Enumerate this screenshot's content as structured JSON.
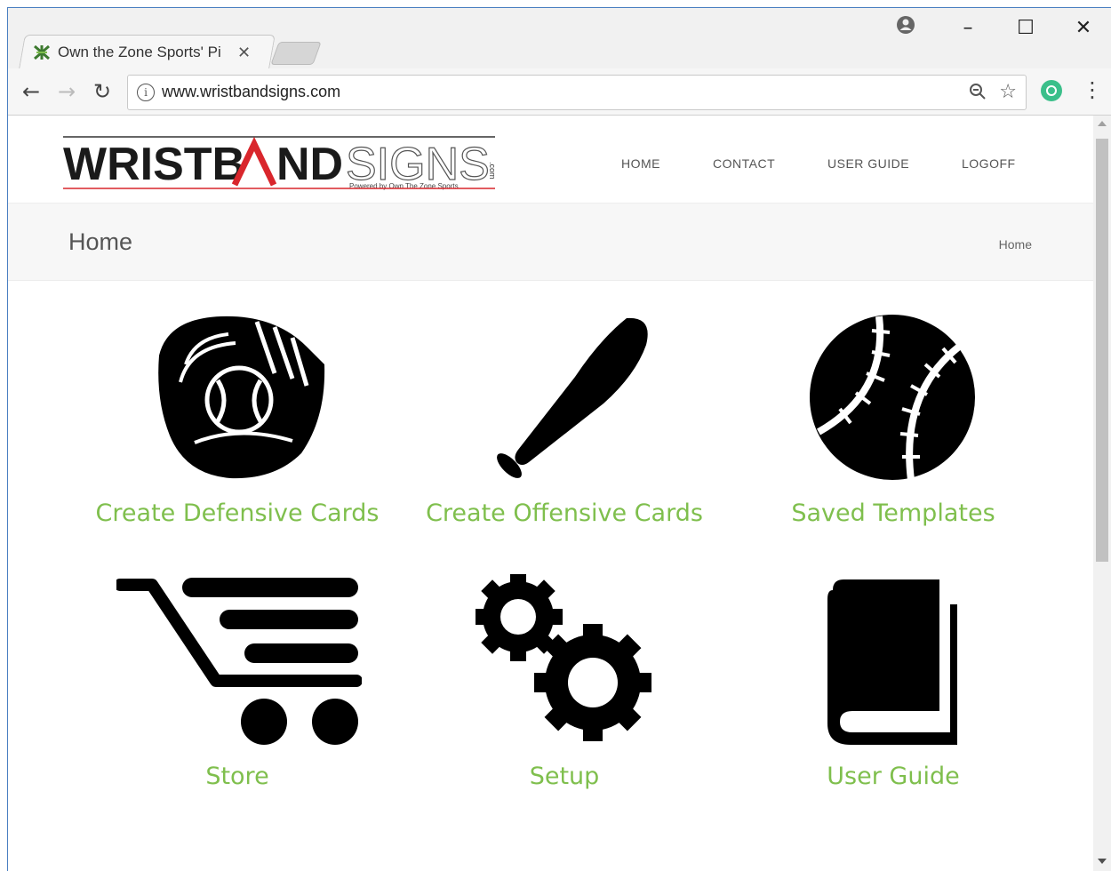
{
  "browser": {
    "tab_title": "Own the Zone Sports' Pi",
    "url": "www.wristbandsigns.com"
  },
  "site": {
    "logo_text_bold": "WRISTB",
    "logo_text_a": "A",
    "logo_text_nd": "ND",
    "logo_text_light": "SIGNS",
    "logo_tagline": "Powered by Own The Zone Sports",
    "logo_suffix": ".com",
    "nav": [
      "HOME",
      "CONTACT",
      "USER GUIDE",
      "LOGOFF"
    ],
    "page_title": "Home",
    "breadcrumb": "Home"
  },
  "tiles": [
    {
      "label": "Create Defensive Cards",
      "icon": "baseball-glove-icon"
    },
    {
      "label": "Create Offensive Cards",
      "icon": "baseball-bat-icon"
    },
    {
      "label": "Saved Templates",
      "icon": "baseball-icon"
    },
    {
      "label": "Store",
      "icon": "shopping-cart-icon"
    },
    {
      "label": "Setup",
      "icon": "gears-icon"
    },
    {
      "label": "User Guide",
      "icon": "book-icon"
    }
  ],
  "colors": {
    "tile_label": "#7fbf4d",
    "logo_accent": "#d9262c"
  }
}
